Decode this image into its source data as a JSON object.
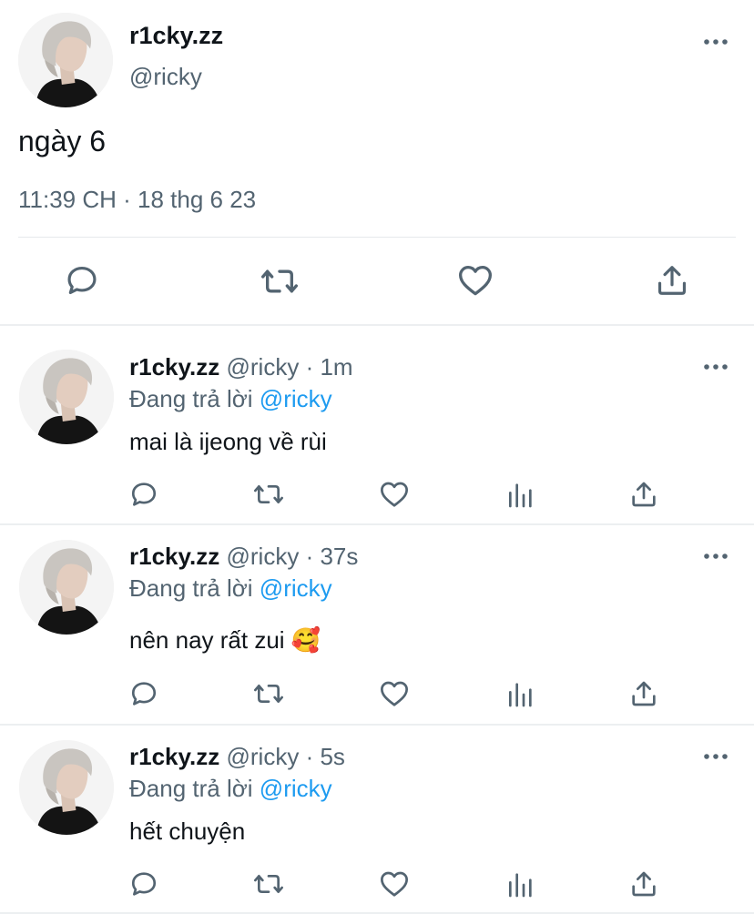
{
  "main_tweet": {
    "display_name": "r1cky.zz",
    "handle": "@ricky",
    "text": "ngày 6",
    "timestamp": "11:39 CH · 18 thg 6 23",
    "avatar_icon": "profile-photo"
  },
  "replies": [
    {
      "display_name": "r1cky.zz",
      "handle": "@ricky",
      "time": "· 1m",
      "replying_to_prefix": "Đang trả lời",
      "replying_to_handle": "@ricky",
      "text": "mai là ijeong về rùi"
    },
    {
      "display_name": "r1cky.zz",
      "handle": "@ricky",
      "time": "· 37s",
      "replying_to_prefix": "Đang trả lời",
      "replying_to_handle": "@ricky",
      "text": "nên nay rất zui",
      "emoji": "🥰"
    },
    {
      "display_name": "r1cky.zz",
      "handle": "@ricky",
      "time": "· 5s",
      "replying_to_prefix": "Đang trả lời",
      "replying_to_handle": "@ricky",
      "text": "hết chuyện"
    }
  ],
  "icons": {
    "more": "more-horizontal-icon",
    "reply": "reply-icon",
    "retweet": "retweet-icon",
    "like": "heart-icon",
    "analytics": "analytics-icon",
    "share": "share-icon"
  },
  "colors": {
    "text": "#0f1419",
    "secondary": "#536471",
    "link": "#1d9bf0",
    "divider": "#e6e9eb"
  }
}
